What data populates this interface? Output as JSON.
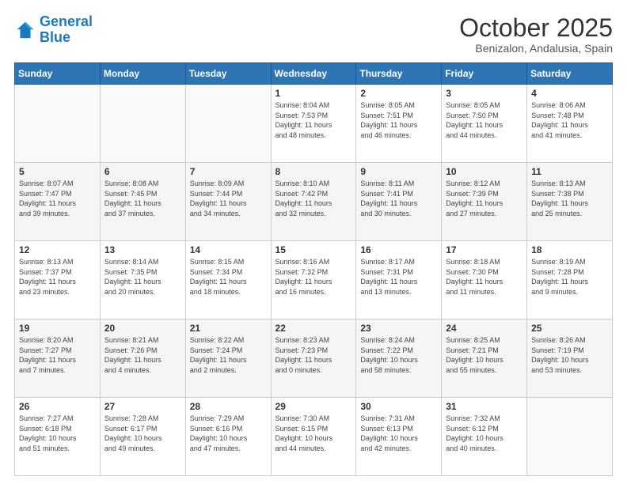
{
  "header": {
    "logo_line1": "General",
    "logo_line2": "Blue",
    "title": "October 2025",
    "subtitle": "Benizalon, Andalusia, Spain"
  },
  "days_of_week": [
    "Sunday",
    "Monday",
    "Tuesday",
    "Wednesday",
    "Thursday",
    "Friday",
    "Saturday"
  ],
  "weeks": [
    [
      {
        "day": "",
        "info": ""
      },
      {
        "day": "",
        "info": ""
      },
      {
        "day": "",
        "info": ""
      },
      {
        "day": "1",
        "info": "Sunrise: 8:04 AM\nSunset: 7:53 PM\nDaylight: 11 hours\nand 48 minutes."
      },
      {
        "day": "2",
        "info": "Sunrise: 8:05 AM\nSunset: 7:51 PM\nDaylight: 11 hours\nand 46 minutes."
      },
      {
        "day": "3",
        "info": "Sunrise: 8:05 AM\nSunset: 7:50 PM\nDaylight: 11 hours\nand 44 minutes."
      },
      {
        "day": "4",
        "info": "Sunrise: 8:06 AM\nSunset: 7:48 PM\nDaylight: 11 hours\nand 41 minutes."
      }
    ],
    [
      {
        "day": "5",
        "info": "Sunrise: 8:07 AM\nSunset: 7:47 PM\nDaylight: 11 hours\nand 39 minutes."
      },
      {
        "day": "6",
        "info": "Sunrise: 8:08 AM\nSunset: 7:45 PM\nDaylight: 11 hours\nand 37 minutes."
      },
      {
        "day": "7",
        "info": "Sunrise: 8:09 AM\nSunset: 7:44 PM\nDaylight: 11 hours\nand 34 minutes."
      },
      {
        "day": "8",
        "info": "Sunrise: 8:10 AM\nSunset: 7:42 PM\nDaylight: 11 hours\nand 32 minutes."
      },
      {
        "day": "9",
        "info": "Sunrise: 8:11 AM\nSunset: 7:41 PM\nDaylight: 11 hours\nand 30 minutes."
      },
      {
        "day": "10",
        "info": "Sunrise: 8:12 AM\nSunset: 7:39 PM\nDaylight: 11 hours\nand 27 minutes."
      },
      {
        "day": "11",
        "info": "Sunrise: 8:13 AM\nSunset: 7:38 PM\nDaylight: 11 hours\nand 25 minutes."
      }
    ],
    [
      {
        "day": "12",
        "info": "Sunrise: 8:13 AM\nSunset: 7:37 PM\nDaylight: 11 hours\nand 23 minutes."
      },
      {
        "day": "13",
        "info": "Sunrise: 8:14 AM\nSunset: 7:35 PM\nDaylight: 11 hours\nand 20 minutes."
      },
      {
        "day": "14",
        "info": "Sunrise: 8:15 AM\nSunset: 7:34 PM\nDaylight: 11 hours\nand 18 minutes."
      },
      {
        "day": "15",
        "info": "Sunrise: 8:16 AM\nSunset: 7:32 PM\nDaylight: 11 hours\nand 16 minutes."
      },
      {
        "day": "16",
        "info": "Sunrise: 8:17 AM\nSunset: 7:31 PM\nDaylight: 11 hours\nand 13 minutes."
      },
      {
        "day": "17",
        "info": "Sunrise: 8:18 AM\nSunset: 7:30 PM\nDaylight: 11 hours\nand 11 minutes."
      },
      {
        "day": "18",
        "info": "Sunrise: 8:19 AM\nSunset: 7:28 PM\nDaylight: 11 hours\nand 9 minutes."
      }
    ],
    [
      {
        "day": "19",
        "info": "Sunrise: 8:20 AM\nSunset: 7:27 PM\nDaylight: 11 hours\nand 7 minutes."
      },
      {
        "day": "20",
        "info": "Sunrise: 8:21 AM\nSunset: 7:26 PM\nDaylight: 11 hours\nand 4 minutes."
      },
      {
        "day": "21",
        "info": "Sunrise: 8:22 AM\nSunset: 7:24 PM\nDaylight: 11 hours\nand 2 minutes."
      },
      {
        "day": "22",
        "info": "Sunrise: 8:23 AM\nSunset: 7:23 PM\nDaylight: 11 hours\nand 0 minutes."
      },
      {
        "day": "23",
        "info": "Sunrise: 8:24 AM\nSunset: 7:22 PM\nDaylight: 10 hours\nand 58 minutes."
      },
      {
        "day": "24",
        "info": "Sunrise: 8:25 AM\nSunset: 7:21 PM\nDaylight: 10 hours\nand 55 minutes."
      },
      {
        "day": "25",
        "info": "Sunrise: 8:26 AM\nSunset: 7:19 PM\nDaylight: 10 hours\nand 53 minutes."
      }
    ],
    [
      {
        "day": "26",
        "info": "Sunrise: 7:27 AM\nSunset: 6:18 PM\nDaylight: 10 hours\nand 51 minutes."
      },
      {
        "day": "27",
        "info": "Sunrise: 7:28 AM\nSunset: 6:17 PM\nDaylight: 10 hours\nand 49 minutes."
      },
      {
        "day": "28",
        "info": "Sunrise: 7:29 AM\nSunset: 6:16 PM\nDaylight: 10 hours\nand 47 minutes."
      },
      {
        "day": "29",
        "info": "Sunrise: 7:30 AM\nSunset: 6:15 PM\nDaylight: 10 hours\nand 44 minutes."
      },
      {
        "day": "30",
        "info": "Sunrise: 7:31 AM\nSunset: 6:13 PM\nDaylight: 10 hours\nand 42 minutes."
      },
      {
        "day": "31",
        "info": "Sunrise: 7:32 AM\nSunset: 6:12 PM\nDaylight: 10 hours\nand 40 minutes."
      },
      {
        "day": "",
        "info": ""
      }
    ]
  ]
}
